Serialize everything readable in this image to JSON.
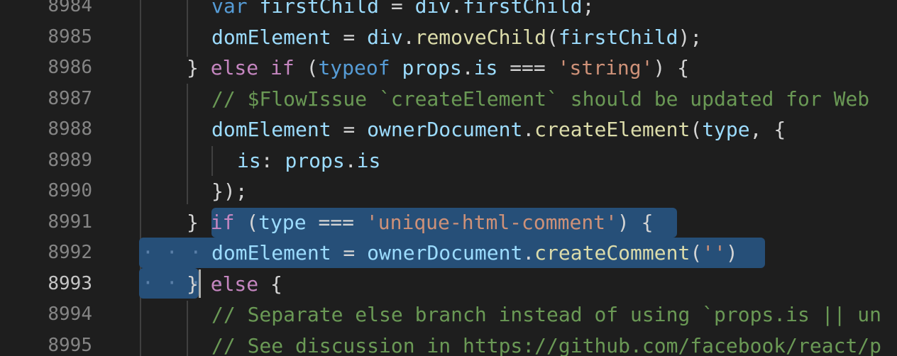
{
  "editor": {
    "lines": [
      {
        "num": "8984",
        "tokens": [
          {
            "t": "var ",
            "c": "kw"
          },
          {
            "t": "firstChild",
            "c": "var"
          },
          {
            "t": " = ",
            "c": "punc"
          },
          {
            "t": "div",
            "c": "var"
          },
          {
            "t": ".",
            "c": "punc"
          },
          {
            "t": "firstChild",
            "c": "var"
          },
          {
            "t": ";",
            "c": "punc"
          }
        ]
      },
      {
        "num": "8985",
        "tokens": [
          {
            "t": "domElement",
            "c": "var"
          },
          {
            "t": " = ",
            "c": "punc"
          },
          {
            "t": "div",
            "c": "var"
          },
          {
            "t": ".",
            "c": "punc"
          },
          {
            "t": "removeChild",
            "c": "fn"
          },
          {
            "t": "(",
            "c": "punc"
          },
          {
            "t": "firstChild",
            "c": "var"
          },
          {
            "t": ");",
            "c": "punc"
          }
        ]
      },
      {
        "num": "8986",
        "tokens": [
          {
            "t": "} ",
            "c": "punc"
          },
          {
            "t": "else",
            "c": "ctl"
          },
          {
            "t": " ",
            "c": "punc"
          },
          {
            "t": "if",
            "c": "ctl"
          },
          {
            "t": " (",
            "c": "punc"
          },
          {
            "t": "typeof",
            "c": "kw"
          },
          {
            "t": " ",
            "c": "punc"
          },
          {
            "t": "props",
            "c": "var"
          },
          {
            "t": ".",
            "c": "punc"
          },
          {
            "t": "is",
            "c": "var"
          },
          {
            "t": " === ",
            "c": "punc"
          },
          {
            "t": "'string'",
            "c": "str"
          },
          {
            "t": ") {",
            "c": "punc"
          }
        ]
      },
      {
        "num": "8987",
        "tokens": [
          {
            "t": "// $FlowIssue `createElement` should be updated for Web",
            "c": "cmt"
          }
        ]
      },
      {
        "num": "8988",
        "tokens": [
          {
            "t": "domElement",
            "c": "var"
          },
          {
            "t": " = ",
            "c": "punc"
          },
          {
            "t": "ownerDocument",
            "c": "var"
          },
          {
            "t": ".",
            "c": "punc"
          },
          {
            "t": "createElement",
            "c": "fn"
          },
          {
            "t": "(",
            "c": "punc"
          },
          {
            "t": "type",
            "c": "var"
          },
          {
            "t": ", {",
            "c": "punc"
          }
        ]
      },
      {
        "num": "8989",
        "tokens": [
          {
            "t": "is",
            "c": "var"
          },
          {
            "t": ": ",
            "c": "punc"
          },
          {
            "t": "props",
            "c": "var"
          },
          {
            "t": ".",
            "c": "punc"
          },
          {
            "t": "is",
            "c": "var"
          }
        ]
      },
      {
        "num": "8990",
        "tokens": [
          {
            "t": "});",
            "c": "punc"
          }
        ]
      },
      {
        "num": "8991",
        "tokens": [
          {
            "t": "} ",
            "c": "punc"
          },
          {
            "t": "if",
            "c": "ctl"
          },
          {
            "t": " (",
            "c": "punc"
          },
          {
            "t": "type",
            "c": "var"
          },
          {
            "t": " === ",
            "c": "punc"
          },
          {
            "t": "'unique-html-comment'",
            "c": "str"
          },
          {
            "t": ") {",
            "c": "punc"
          }
        ]
      },
      {
        "num": "8992",
        "tokens": [
          {
            "t": "domElement",
            "c": "var"
          },
          {
            "t": " = ",
            "c": "punc"
          },
          {
            "t": "ownerDocument",
            "c": "var"
          },
          {
            "t": ".",
            "c": "punc"
          },
          {
            "t": "createComment",
            "c": "fn"
          },
          {
            "t": "(",
            "c": "punc"
          },
          {
            "t": "''",
            "c": "str"
          },
          {
            "t": ")",
            "c": "punc"
          }
        ]
      },
      {
        "num": "8993",
        "tokens": [
          {
            "t": "}",
            "c": "punc"
          },
          {
            "t": " ",
            "c": "punc"
          },
          {
            "t": "else",
            "c": "ctl"
          },
          {
            "t": " {",
            "c": "punc"
          }
        ]
      },
      {
        "num": "8994",
        "tokens": [
          {
            "t": "// Separate else branch instead of using `props.is || un",
            "c": "cmt"
          }
        ]
      },
      {
        "num": "8995",
        "tokens": [
          {
            "t": "// See discussion in https://github.com/facebook/react/p",
            "c": "cmt"
          }
        ]
      }
    ],
    "active_line": "8993",
    "whitespace_marker": "· · · ·"
  }
}
